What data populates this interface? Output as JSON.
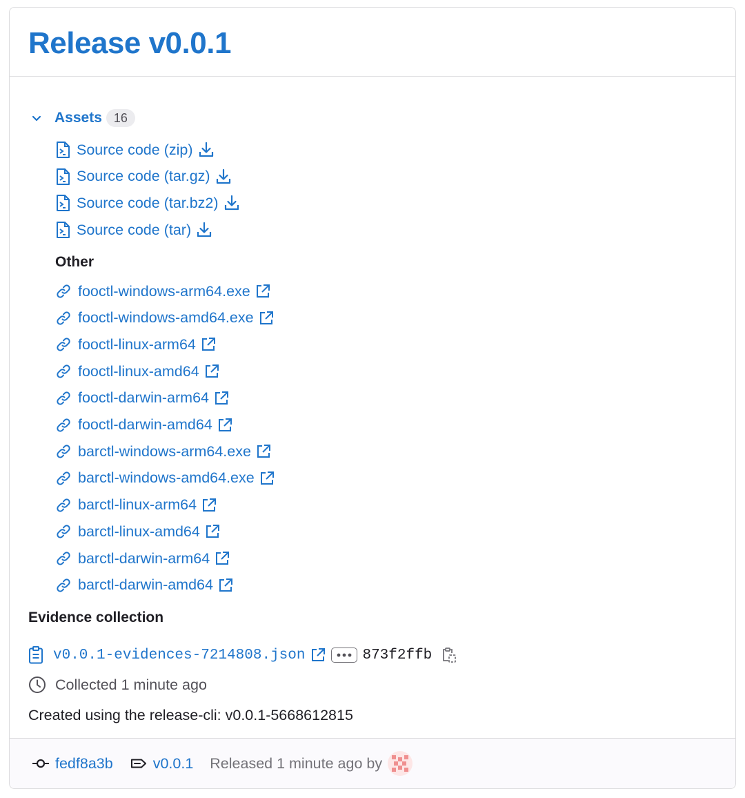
{
  "release": {
    "title": "Release v0.0.1"
  },
  "assets": {
    "label": "Assets",
    "count": "16",
    "sources": [
      {
        "label": "Source code (zip)"
      },
      {
        "label": "Source code (tar.gz)"
      },
      {
        "label": "Source code (tar.bz2)"
      },
      {
        "label": "Source code (tar)"
      }
    ],
    "other_heading": "Other",
    "other": [
      {
        "label": "fooctl-windows-arm64.exe"
      },
      {
        "label": "fooctl-windows-amd64.exe"
      },
      {
        "label": "fooctl-linux-arm64"
      },
      {
        "label": "fooctl-linux-amd64"
      },
      {
        "label": "fooctl-darwin-arm64"
      },
      {
        "label": "fooctl-darwin-amd64"
      },
      {
        "label": "barctl-windows-arm64.exe"
      },
      {
        "label": "barctl-windows-amd64.exe"
      },
      {
        "label": "barctl-linux-arm64"
      },
      {
        "label": "barctl-linux-amd64"
      },
      {
        "label": "barctl-darwin-arm64"
      },
      {
        "label": "barctl-darwin-amd64"
      }
    ]
  },
  "evidence": {
    "heading": "Evidence collection",
    "file": "v0.0.1-evidences-7214808.json",
    "sha": "873f2ffb",
    "collected": "Collected 1 minute ago"
  },
  "description": "Created using the release-cli: v0.0.1-5668612815",
  "footer": {
    "commit": "fedf8a3b",
    "tag": "v0.0.1",
    "released": "Released 1 minute ago by"
  },
  "colors": {
    "link": "#1f75cb",
    "text": "#1f1e24",
    "muted": "#737278",
    "border": "#dcdcde"
  },
  "icons": {
    "chevron": "chevron-down-icon",
    "source": "doc-code-icon",
    "download": "download-icon",
    "link": "link-icon",
    "external": "external-link-icon",
    "clipboard": "clipboard-icon",
    "clock": "clock-icon",
    "commit": "commit-icon",
    "tag": "tag-icon"
  }
}
